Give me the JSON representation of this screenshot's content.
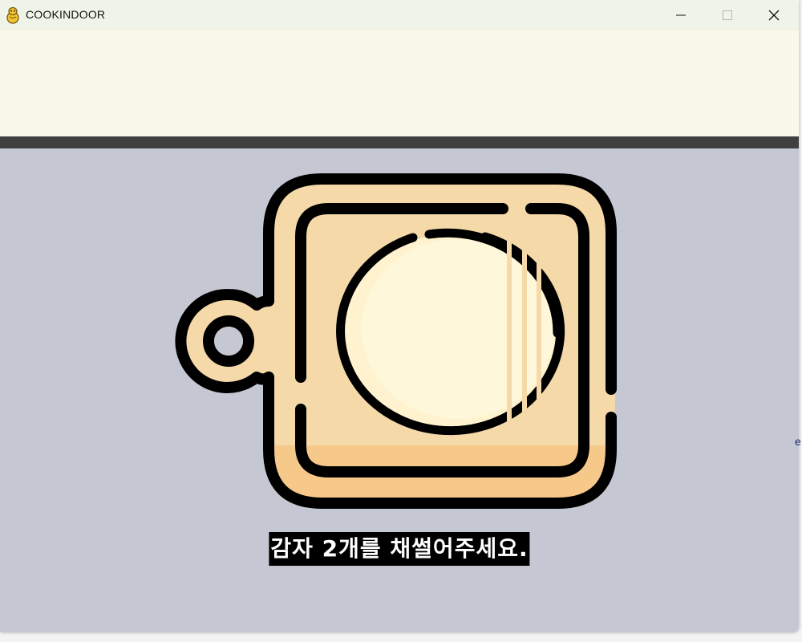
{
  "window": {
    "title": "COOKINDOOR",
    "icon": "pygame-snake-icon"
  },
  "controls": {
    "minimize": "minimize-icon",
    "maximize": "maximize-icon",
    "close": "close-icon"
  },
  "colors": {
    "top_panel": "#faf8e8",
    "divider": "#3f3f3f",
    "stage": "#c5c7d3",
    "board": "#f5d9a8",
    "potato": "#fff5d4"
  },
  "stage": {
    "illustration": "cutting-board-with-potato-icon",
    "instruction": "감자 2개를 채썰어주세요."
  },
  "background_edge_text": "e"
}
